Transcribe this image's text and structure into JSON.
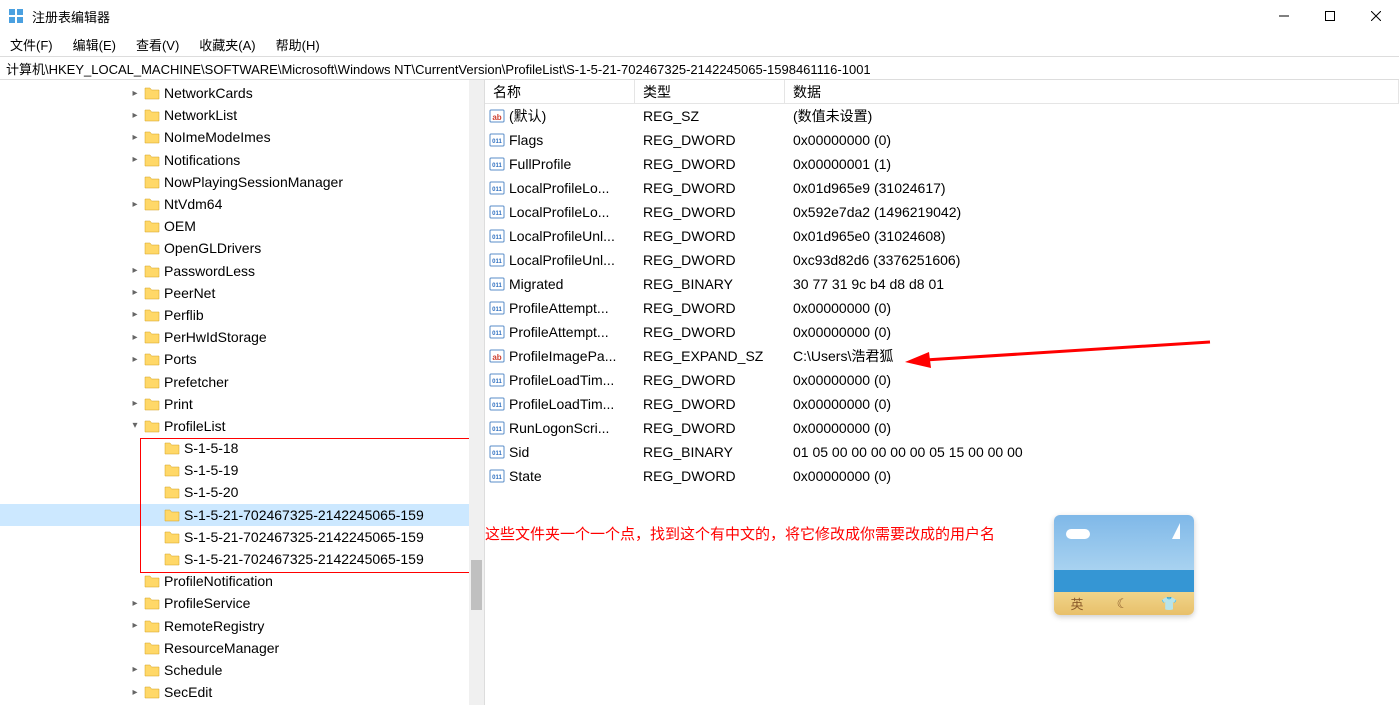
{
  "window": {
    "title": "注册表编辑器"
  },
  "menubar": [
    "文件(F)",
    "编辑(E)",
    "查看(V)",
    "收藏夹(A)",
    "帮助(H)"
  ],
  "pathbar": "计算机\\HKEY_LOCAL_MACHINE\\SOFTWARE\\Microsoft\\Windows NT\\CurrentVersion\\ProfileList\\S-1-5-21-702467325-2142245065-1598461116-1001",
  "tree": [
    {
      "indent": 128,
      "exp": "▸",
      "label": "NetworkCards"
    },
    {
      "indent": 128,
      "exp": "▸",
      "label": "NetworkList"
    },
    {
      "indent": 128,
      "exp": "▸",
      "label": "NoImeModeImes"
    },
    {
      "indent": 128,
      "exp": "▸",
      "label": "Notifications"
    },
    {
      "indent": 128,
      "exp": "",
      "label": "NowPlayingSessionManager"
    },
    {
      "indent": 128,
      "exp": "▸",
      "label": "NtVdm64"
    },
    {
      "indent": 128,
      "exp": "",
      "label": "OEM"
    },
    {
      "indent": 128,
      "exp": "",
      "label": "OpenGLDrivers"
    },
    {
      "indent": 128,
      "exp": "▸",
      "label": "PasswordLess"
    },
    {
      "indent": 128,
      "exp": "▸",
      "label": "PeerNet"
    },
    {
      "indent": 128,
      "exp": "▸",
      "label": "Perflib"
    },
    {
      "indent": 128,
      "exp": "▸",
      "label": "PerHwIdStorage"
    },
    {
      "indent": 128,
      "exp": "▸",
      "label": "Ports"
    },
    {
      "indent": 128,
      "exp": "",
      "label": "Prefetcher"
    },
    {
      "indent": 128,
      "exp": "▸",
      "label": "Print"
    },
    {
      "indent": 128,
      "exp": "▾",
      "label": "ProfileList"
    },
    {
      "indent": 148,
      "exp": "",
      "label": "S-1-5-18"
    },
    {
      "indent": 148,
      "exp": "",
      "label": "S-1-5-19"
    },
    {
      "indent": 148,
      "exp": "",
      "label": "S-1-5-20"
    },
    {
      "indent": 148,
      "exp": "",
      "label": "S-1-5-21-702467325-2142245065-159",
      "selected": true
    },
    {
      "indent": 148,
      "exp": "",
      "label": "S-1-5-21-702467325-2142245065-159"
    },
    {
      "indent": 148,
      "exp": "",
      "label": "S-1-5-21-702467325-2142245065-159"
    },
    {
      "indent": 128,
      "exp": "",
      "label": "ProfileNotification"
    },
    {
      "indent": 128,
      "exp": "▸",
      "label": "ProfileService"
    },
    {
      "indent": 128,
      "exp": "▸",
      "label": "RemoteRegistry"
    },
    {
      "indent": 128,
      "exp": "",
      "label": "ResourceManager"
    },
    {
      "indent": 128,
      "exp": "▸",
      "label": "Schedule"
    },
    {
      "indent": 128,
      "exp": "▸",
      "label": "SecEdit"
    }
  ],
  "columns": {
    "name": "名称",
    "type": "类型",
    "data": "数据"
  },
  "values": [
    {
      "icon": "sz",
      "name": "(默认)",
      "type": "REG_SZ",
      "data": "(数值未设置)"
    },
    {
      "icon": "dw",
      "name": "Flags",
      "type": "REG_DWORD",
      "data": "0x00000000 (0)"
    },
    {
      "icon": "dw",
      "name": "FullProfile",
      "type": "REG_DWORD",
      "data": "0x00000001 (1)"
    },
    {
      "icon": "dw",
      "name": "LocalProfileLo...",
      "type": "REG_DWORD",
      "data": "0x01d965e9 (31024617)"
    },
    {
      "icon": "dw",
      "name": "LocalProfileLo...",
      "type": "REG_DWORD",
      "data": "0x592e7da2 (1496219042)"
    },
    {
      "icon": "dw",
      "name": "LocalProfileUnl...",
      "type": "REG_DWORD",
      "data": "0x01d965e0 (31024608)"
    },
    {
      "icon": "dw",
      "name": "LocalProfileUnl...",
      "type": "REG_DWORD",
      "data": "0xc93d82d6 (3376251606)"
    },
    {
      "icon": "dw",
      "name": "Migrated",
      "type": "REG_BINARY",
      "data": "30 77 31 9c b4 d8 d8 01"
    },
    {
      "icon": "dw",
      "name": "ProfileAttempt...",
      "type": "REG_DWORD",
      "data": "0x00000000 (0)"
    },
    {
      "icon": "dw",
      "name": "ProfileAttempt...",
      "type": "REG_DWORD",
      "data": "0x00000000 (0)"
    },
    {
      "icon": "sz",
      "name": "ProfileImagePa...",
      "type": "REG_EXPAND_SZ",
      "data": "C:\\Users\\浩君狐"
    },
    {
      "icon": "dw",
      "name": "ProfileLoadTim...",
      "type": "REG_DWORD",
      "data": "0x00000000 (0)"
    },
    {
      "icon": "dw",
      "name": "ProfileLoadTim...",
      "type": "REG_DWORD",
      "data": "0x00000000 (0)"
    },
    {
      "icon": "dw",
      "name": "RunLogonScri...",
      "type": "REG_DWORD",
      "data": "0x00000000 (0)"
    },
    {
      "icon": "dw",
      "name": "Sid",
      "type": "REG_BINARY",
      "data": "01 05 00 00 00 00 00 05 15 00 00 00"
    },
    {
      "icon": "dw",
      "name": "State",
      "type": "REG_DWORD",
      "data": "0x00000000 (0)"
    }
  ],
  "annotation": "这些文件夹一个一个点，找到这个有中文的，将它修改成你需要改成的用户名",
  "ime": {
    "char": "英"
  }
}
